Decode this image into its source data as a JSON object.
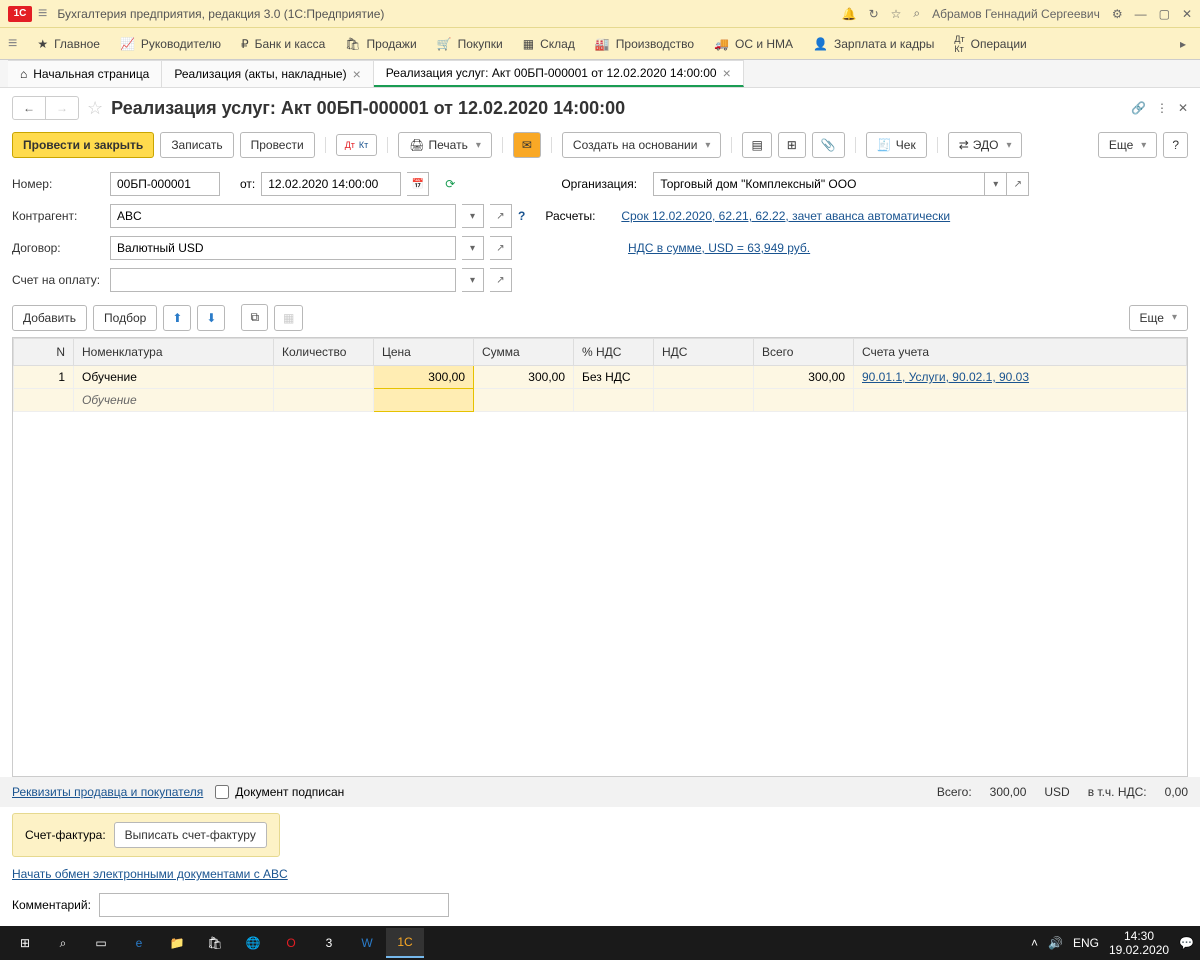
{
  "titlebar": {
    "appTitle": "Бухгалтерия предприятия, редакция 3.0  (1С:Предприятие)",
    "user": "Абрамов Геннадий Сергеевич"
  },
  "mainmenu": {
    "items": [
      "Главное",
      "Руководителю",
      "Банк и касса",
      "Продажи",
      "Покупки",
      "Склад",
      "Производство",
      "ОС и НМА",
      "Зарплата и кадры",
      "Операции"
    ]
  },
  "tabs": {
    "home": "Начальная страница",
    "t1": "Реализация (акты, накладные)",
    "t2": "Реализация услуг: Акт 00БП-000001 от 12.02.2020 14:00:00"
  },
  "docTitle": "Реализация услуг: Акт 00БП-000001 от 12.02.2020 14:00:00",
  "toolbar": {
    "postClose": "Провести и закрыть",
    "write": "Записать",
    "post": "Провести",
    "print": "Печать",
    "createBasis": "Создать на основании",
    "check": "Чек",
    "edo": "ЭДО",
    "more": "Еще"
  },
  "form": {
    "numberLabel": "Номер:",
    "numberVal": "00БП-000001",
    "fromLabel": "от:",
    "dateVal": "12.02.2020 14:00:00",
    "orgLabel": "Организация:",
    "orgVal": "Торговый дом \"Комплексный\" ООО",
    "agentLabel": "Контрагент:",
    "agentVal": "ABC",
    "calcLabel": "Расчеты:",
    "calcLink": "Срок 12.02.2020, 62.21, 62.22, зачет аванса автоматически",
    "contractLabel": "Договор:",
    "contractVal": "Валютный USD",
    "ndsLink": "НДС в сумме, USD = 63,949 руб.",
    "invoiceBillLabel": "Счет на оплату:"
  },
  "tableToolbar": {
    "add": "Добавить",
    "pick": "Подбор",
    "more": "Еще"
  },
  "table": {
    "headers": [
      "N",
      "Номенклатура",
      "Количество",
      "Цена",
      "Сумма",
      "% НДС",
      "НДС",
      "Всего",
      "Счета учета"
    ],
    "row": {
      "n": "1",
      "nom": "Обучение",
      "nomSub": "Обучение",
      "price": "300,00",
      "sum": "300,00",
      "ndsPct": "Без НДС",
      "total": "300,00",
      "accounts": "90.01.1, Услуги, 90.02.1, 90.03"
    }
  },
  "totals": {
    "sellerBuyerLink": "Реквизиты продавца и покупателя",
    "docSigned": "Документ подписан",
    "totalLabel": "Всего:",
    "totalVal": "300,00",
    "currency": "USD",
    "inclNdsLabel": "в т.ч. НДС:",
    "inclNdsVal": "0,00"
  },
  "invoice": {
    "label": "Счет-фактура:",
    "btn": "Выписать счет-фактуру"
  },
  "edoLink": "Начать обмен электронными документами с ABC",
  "commentLabel": "Комментарий:",
  "taskbar": {
    "lang": "ENG",
    "time": "14:30",
    "date": "19.02.2020"
  }
}
